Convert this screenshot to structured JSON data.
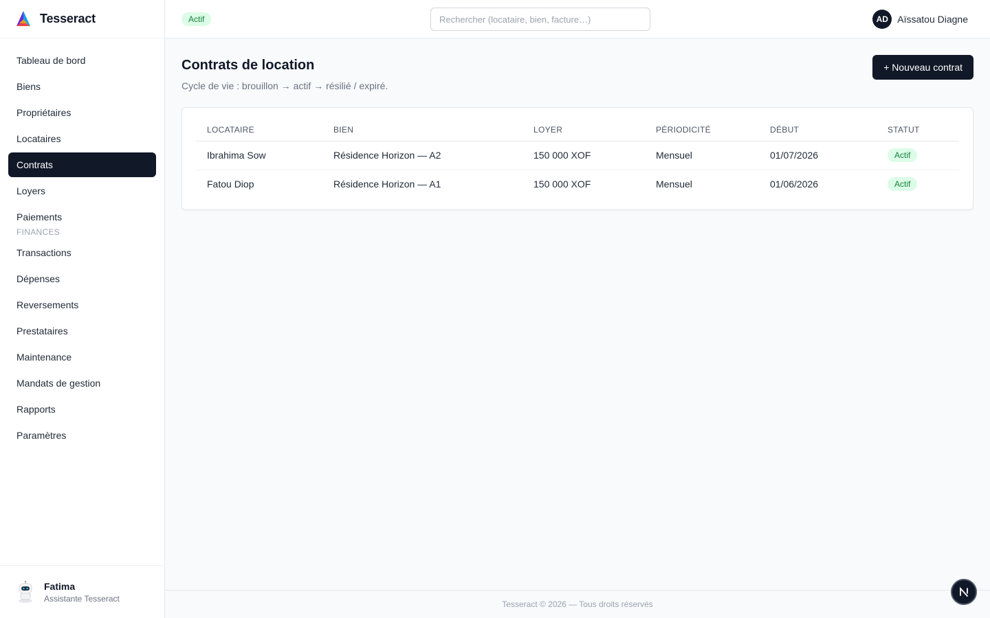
{
  "brand": {
    "name": "Tesseract"
  },
  "sidebar": {
    "items": [
      {
        "label": "Tableau de bord"
      },
      {
        "label": "Biens"
      },
      {
        "label": "Propriétaires"
      },
      {
        "label": "Locataires"
      },
      {
        "label": "Contrats",
        "active": true
      },
      {
        "label": "Loyers"
      },
      {
        "label": "Paiements"
      }
    ],
    "section_label": "FINANCES",
    "finance_items": [
      {
        "label": "Transactions"
      },
      {
        "label": "Dépenses"
      },
      {
        "label": "Reversements"
      },
      {
        "label": "Prestataires"
      },
      {
        "label": "Maintenance"
      },
      {
        "label": "Mandats de gestion"
      },
      {
        "label": "Rapports"
      },
      {
        "label": "Paramètres"
      }
    ],
    "assistant": {
      "name": "Fatima",
      "role": "Assistante Tesseract",
      "icon": "robot-icon"
    }
  },
  "topbar": {
    "status_badge": "Actif",
    "search_placeholder": "Rechercher (locataire, bien, facture…)",
    "user": {
      "initials": "AD",
      "name": "Aïssatou Diagne"
    }
  },
  "main": {
    "title": "Contrats de location",
    "subtitle": "Cycle de vie : brouillon → actif → résilié / expiré.",
    "new_button": "+ Nouveau contrat",
    "table": {
      "columns": [
        "LOCATAIRE",
        "BIEN",
        "LOYER",
        "PÉRIODICITÉ",
        "DÉBUT",
        "STATUT"
      ],
      "rows": [
        {
          "locataire": "Ibrahima Sow",
          "bien": "Résidence Horizon — A2",
          "loyer": "150 000 XOF",
          "periodicite": "Mensuel",
          "debut": "01/07/2026",
          "statut": "Actif"
        },
        {
          "locataire": "Fatou Diop",
          "bien": "Résidence Horizon — A1",
          "loyer": "150 000 XOF",
          "periodicite": "Mensuel",
          "debut": "01/06/2026",
          "statut": "Actif"
        }
      ]
    }
  },
  "footer": {
    "text": "Tesseract © 2026 — Tous droits réservés"
  },
  "floating_button": {
    "label": "N"
  },
  "colors": {
    "primary": "#111827",
    "badge_bg": "#dcfce7",
    "badge_text": "#15803d",
    "background": "#f8fafc"
  }
}
